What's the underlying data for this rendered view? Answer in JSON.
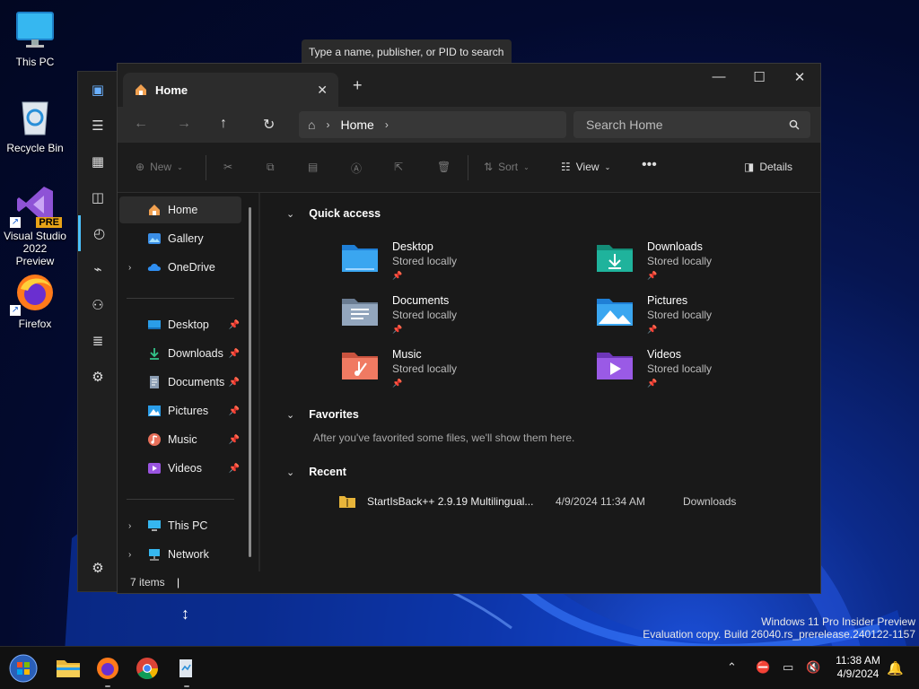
{
  "desktop": {
    "icons": [
      {
        "label": "This PC"
      },
      {
        "label": "Recycle Bin"
      },
      {
        "label": "Visual Studio 2022 Preview",
        "badge": "PRE"
      },
      {
        "label": "Firefox"
      }
    ]
  },
  "task_manager": {
    "search_placeholder": "Type a name, publisher, or PID to search"
  },
  "explorer": {
    "tab_title": "Home",
    "breadcrumb": "Home",
    "search_placeholder": "Search Home",
    "commands": {
      "new": "New",
      "sort": "Sort",
      "view": "View",
      "details": "Details"
    },
    "nav": {
      "home": "Home",
      "gallery": "Gallery",
      "onedrive": "OneDrive",
      "desktop": "Desktop",
      "downloads": "Downloads",
      "documents": "Documents",
      "pictures": "Pictures",
      "music": "Music",
      "videos": "Videos",
      "this_pc": "This PC",
      "network": "Network"
    },
    "sections": {
      "quick_access": "Quick access",
      "favorites": "Favorites",
      "recent": "Recent"
    },
    "quick_access": [
      {
        "name": "Desktop",
        "sub": "Stored locally"
      },
      {
        "name": "Downloads",
        "sub": "Stored locally"
      },
      {
        "name": "Documents",
        "sub": "Stored locally"
      },
      {
        "name": "Pictures",
        "sub": "Stored locally"
      },
      {
        "name": "Music",
        "sub": "Stored locally"
      },
      {
        "name": "Videos",
        "sub": "Stored locally"
      }
    ],
    "favorites_message": "After you've favorited some files, we'll show them here.",
    "recent": [
      {
        "name": "StartIsBack++ 2.9.19 Multilingual...",
        "date": "4/9/2024 11:34 AM",
        "location": "Downloads"
      }
    ],
    "status": "7 items"
  },
  "watermark": {
    "line1": "Windows 11 Pro Insider Preview",
    "line2": "Evaluation copy. Build 26040.rs_prerelease.240122-1157"
  },
  "taskbar": {
    "time": "11:38 AM",
    "date": "4/9/2024"
  },
  "colors": {
    "accent": "#4cc2ff",
    "folder_blue": "#3a8ee6",
    "folder_teal": "#1fb39c"
  }
}
